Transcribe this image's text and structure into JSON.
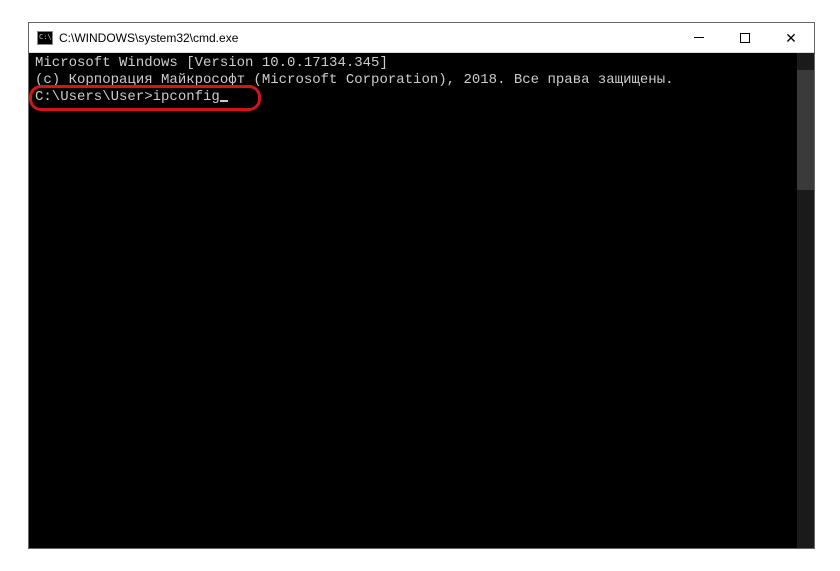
{
  "window": {
    "title": "C:\\WINDOWS\\system32\\cmd.exe"
  },
  "terminal": {
    "line1": "Microsoft Windows [Version 10.0.17134.345]",
    "line2": "(c) Корпорация Майкрософт (Microsoft Corporation), 2018. Все права защищены.",
    "blank": "",
    "prompt": "C:\\Users\\User>",
    "command": "ipconfig"
  }
}
